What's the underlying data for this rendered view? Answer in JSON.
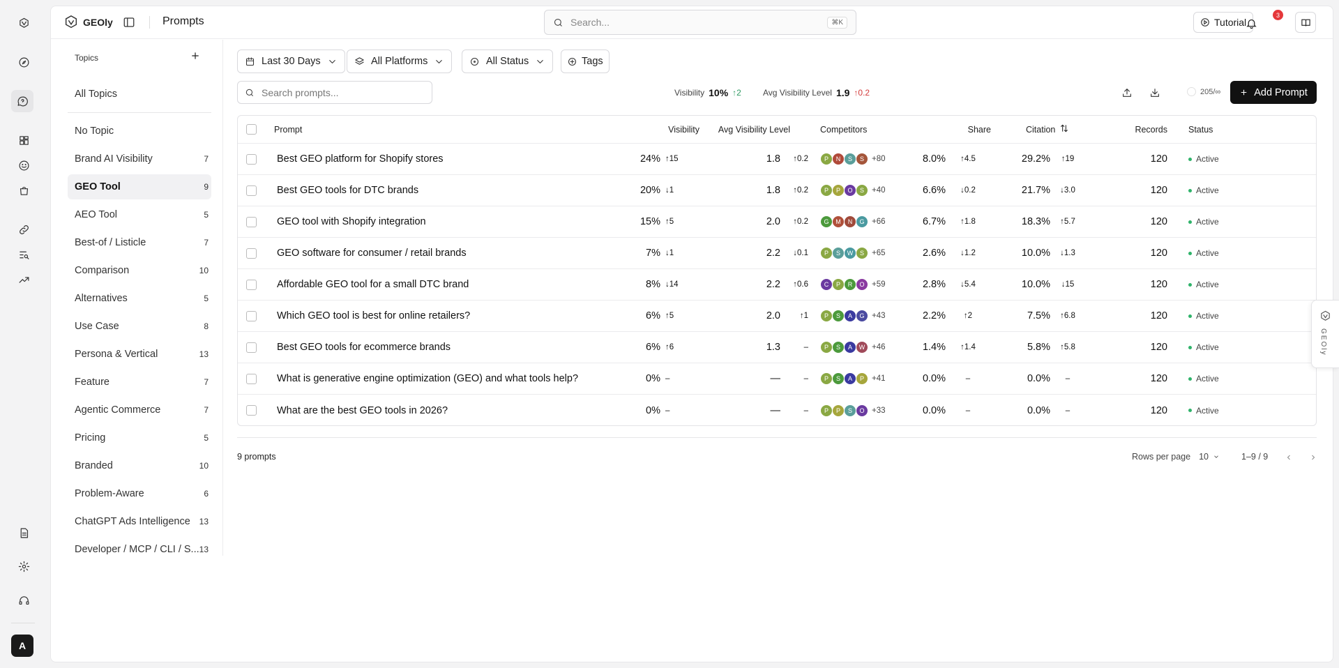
{
  "app": {
    "name": "GEOly",
    "page_title": "Prompts"
  },
  "search": {
    "placeholder": "Search...",
    "shortcut": "⌘K"
  },
  "header": {
    "tutorial_label": "Tutorial",
    "notification_count": "3"
  },
  "topics": {
    "heading": "Topics",
    "all_label": "All Topics",
    "items": [
      {
        "label": "No Topic",
        "count": ""
      },
      {
        "label": "Brand AI Visibility",
        "count": "7"
      },
      {
        "label": "GEO Tool",
        "count": "9",
        "selected": true
      },
      {
        "label": "AEO Tool",
        "count": "5"
      },
      {
        "label": "Best-of / Listicle",
        "count": "7"
      },
      {
        "label": "Comparison",
        "count": "10"
      },
      {
        "label": "Alternatives",
        "count": "5"
      },
      {
        "label": "Use Case",
        "count": "8"
      },
      {
        "label": "Persona & Vertical",
        "count": "13"
      },
      {
        "label": "Feature",
        "count": "7"
      },
      {
        "label": "Agentic Commerce",
        "count": "7"
      },
      {
        "label": "Pricing",
        "count": "5"
      },
      {
        "label": "Branded",
        "count": "10"
      },
      {
        "label": "Problem-Aware",
        "count": "6"
      },
      {
        "label": "ChatGPT Ads Intelligence",
        "count": "13"
      },
      {
        "label": "Developer / MCP / CLI / S...",
        "count": "13"
      }
    ]
  },
  "filters": {
    "date": "Last 30 Days",
    "platforms": "All Platforms",
    "status": "All Status",
    "tags": "Tags"
  },
  "prompt_search": {
    "placeholder": "Search prompts..."
  },
  "summary": {
    "visibility_label": "Visibility",
    "visibility_value": "10%",
    "visibility_delta": "↑2",
    "avg_level_label": "Avg Visibility Level",
    "avg_level_value": "1.9",
    "avg_level_delta": "↑0.2",
    "quota": "205/∞",
    "add_prompt": "Add Prompt"
  },
  "table": {
    "columns": {
      "prompt": "Prompt",
      "visibility": "Visibility",
      "avg_level": "Avg Visibility Level",
      "competitors": "Competitors",
      "share": "Share",
      "citation": "Citation",
      "records": "Records",
      "status": "Status"
    },
    "rows": [
      {
        "prompt": "Best GEO platform for Shopify stores",
        "vis": "24%",
        "vis_d": "↑15",
        "vis_t": "up",
        "lvl": "1.8",
        "lvl_d": "↑0.2",
        "lvl_t": "down",
        "comps": [
          [
            "P",
            "#8aa843"
          ],
          [
            "N",
            "#b04a3a"
          ],
          [
            "S",
            "#5a9e9a"
          ],
          [
            "S",
            "#a4553a"
          ]
        ],
        "more": "+80",
        "share": "8.0%",
        "share_d": "↑4.5",
        "share_t": "up",
        "cit": "29.2%",
        "cit_d": "↑19",
        "cit_t": "up",
        "rec": "120",
        "status": "Active"
      },
      {
        "prompt": "Best GEO tools for DTC brands",
        "vis": "20%",
        "vis_d": "↓1",
        "vis_t": "down",
        "lvl": "1.8",
        "lvl_d": "↑0.2",
        "lvl_t": "down",
        "comps": [
          [
            "P",
            "#8aa843"
          ],
          [
            "P",
            "#a6a63c"
          ],
          [
            "O",
            "#6a3aa0"
          ],
          [
            "S",
            "#8aa843"
          ]
        ],
        "more": "+40",
        "share": "6.6%",
        "share_d": "↓0.2",
        "share_t": "down",
        "cit": "21.7%",
        "cit_d": "↓3.0",
        "cit_t": "down",
        "rec": "120",
        "status": "Active"
      },
      {
        "prompt": "GEO tool with Shopify integration",
        "vis": "15%",
        "vis_d": "↑5",
        "vis_t": "up",
        "lvl": "2.0",
        "lvl_d": "↑0.2",
        "lvl_t": "down",
        "comps": [
          [
            "G",
            "#4c9a3c"
          ],
          [
            "M",
            "#b0503a"
          ],
          [
            "N",
            "#a04a3a"
          ],
          [
            "G",
            "#4a9aa0"
          ]
        ],
        "more": "+66",
        "share": "6.7%",
        "share_d": "↑1.8",
        "share_t": "up",
        "cit": "18.3%",
        "cit_d": "↑5.7",
        "cit_t": "up",
        "rec": "120",
        "status": "Active"
      },
      {
        "prompt": "GEO software for consumer / retail brands",
        "vis": "7%",
        "vis_d": "↓1",
        "vis_t": "down",
        "lvl": "2.2",
        "lvl_d": "↓0.1",
        "lvl_t": "up",
        "comps": [
          [
            "P",
            "#8aa843"
          ],
          [
            "S",
            "#5a9e9a"
          ],
          [
            "W",
            "#4a9aa0"
          ],
          [
            "S",
            "#8aa843"
          ]
        ],
        "more": "+65",
        "share": "2.6%",
        "share_d": "↓1.2",
        "share_t": "down",
        "cit": "10.0%",
        "cit_d": "↓1.3",
        "cit_t": "down",
        "rec": "120",
        "status": "Active"
      },
      {
        "prompt": "Affordable GEO tool for a small DTC brand",
        "vis": "8%",
        "vis_d": "↓14",
        "vis_t": "down",
        "lvl": "2.2",
        "lvl_d": "↑0.6",
        "lvl_t": "down",
        "comps": [
          [
            "C",
            "#6a3aa0"
          ],
          [
            "P",
            "#8aa843"
          ],
          [
            "R",
            "#4c9a3c"
          ],
          [
            "O",
            "#8a3aa0"
          ]
        ],
        "more": "+59",
        "share": "2.8%",
        "share_d": "↓5.4",
        "share_t": "down",
        "cit": "10.0%",
        "cit_d": "↓15",
        "cit_t": "down",
        "rec": "120",
        "status": "Active"
      },
      {
        "prompt": "Which GEO tool is best for online retailers?",
        "vis": "6%",
        "vis_d": "↑5",
        "vis_t": "up",
        "lvl": "2.0",
        "lvl_d": "↑1",
        "lvl_t": "down",
        "comps": [
          [
            "P",
            "#8aa843"
          ],
          [
            "S",
            "#4c9a3c"
          ],
          [
            "A",
            "#3a3aa0"
          ],
          [
            "G",
            "#4a4aa0"
          ]
        ],
        "more": "+43",
        "share": "2.2%",
        "share_d": "↑2",
        "share_t": "up",
        "cit": "7.5%",
        "cit_d": "↑6.8",
        "cit_t": "up",
        "rec": "120",
        "status": "Active"
      },
      {
        "prompt": "Best GEO tools for ecommerce brands",
        "vis": "6%",
        "vis_d": "↑6",
        "vis_t": "up",
        "lvl": "1.3",
        "lvl_d": "–",
        "lvl_t": "neu",
        "comps": [
          [
            "P",
            "#8aa843"
          ],
          [
            "S",
            "#4c9a3c"
          ],
          [
            "A",
            "#3a3aa0"
          ],
          [
            "W",
            "#a04a5a"
          ]
        ],
        "more": "+46",
        "share": "1.4%",
        "share_d": "↑1.4",
        "share_t": "up",
        "cit": "5.8%",
        "cit_d": "↑5.8",
        "cit_t": "up",
        "rec": "120",
        "status": "Active"
      },
      {
        "prompt": "What is generative engine optimization (GEO) and what tools help?",
        "vis": "0%",
        "vis_d": "–",
        "vis_t": "neu",
        "lvl": "—",
        "lvl_d": "–",
        "lvl_t": "neu",
        "comps": [
          [
            "P",
            "#8aa843"
          ],
          [
            "S",
            "#4c9a3c"
          ],
          [
            "A",
            "#3a3aa0"
          ],
          [
            "P",
            "#a6a63c"
          ]
        ],
        "more": "+41",
        "share": "0.0%",
        "share_d": "–",
        "share_t": "neu",
        "cit": "0.0%",
        "cit_d": "–",
        "cit_t": "neu",
        "rec": "120",
        "status": "Active"
      },
      {
        "prompt": "What are the best GEO tools in 2026?",
        "vis": "0%",
        "vis_d": "–",
        "vis_t": "neu",
        "lvl": "—",
        "lvl_d": "–",
        "lvl_t": "neu",
        "comps": [
          [
            "P",
            "#8aa843"
          ],
          [
            "P",
            "#a6a63c"
          ],
          [
            "S",
            "#5a9e9a"
          ],
          [
            "O",
            "#6a3aa0"
          ]
        ],
        "more": "+33",
        "share": "0.0%",
        "share_d": "–",
        "share_t": "neu",
        "cit": "0.0%",
        "cit_d": "–",
        "cit_t": "neu",
        "rec": "120",
        "status": "Active"
      }
    ]
  },
  "footer": {
    "count": "9 prompts",
    "rows_per_page_label": "Rows per page",
    "rows_per_page": "10",
    "range": "1–9 / 9"
  },
  "side_tab": {
    "label": "GEOly"
  }
}
